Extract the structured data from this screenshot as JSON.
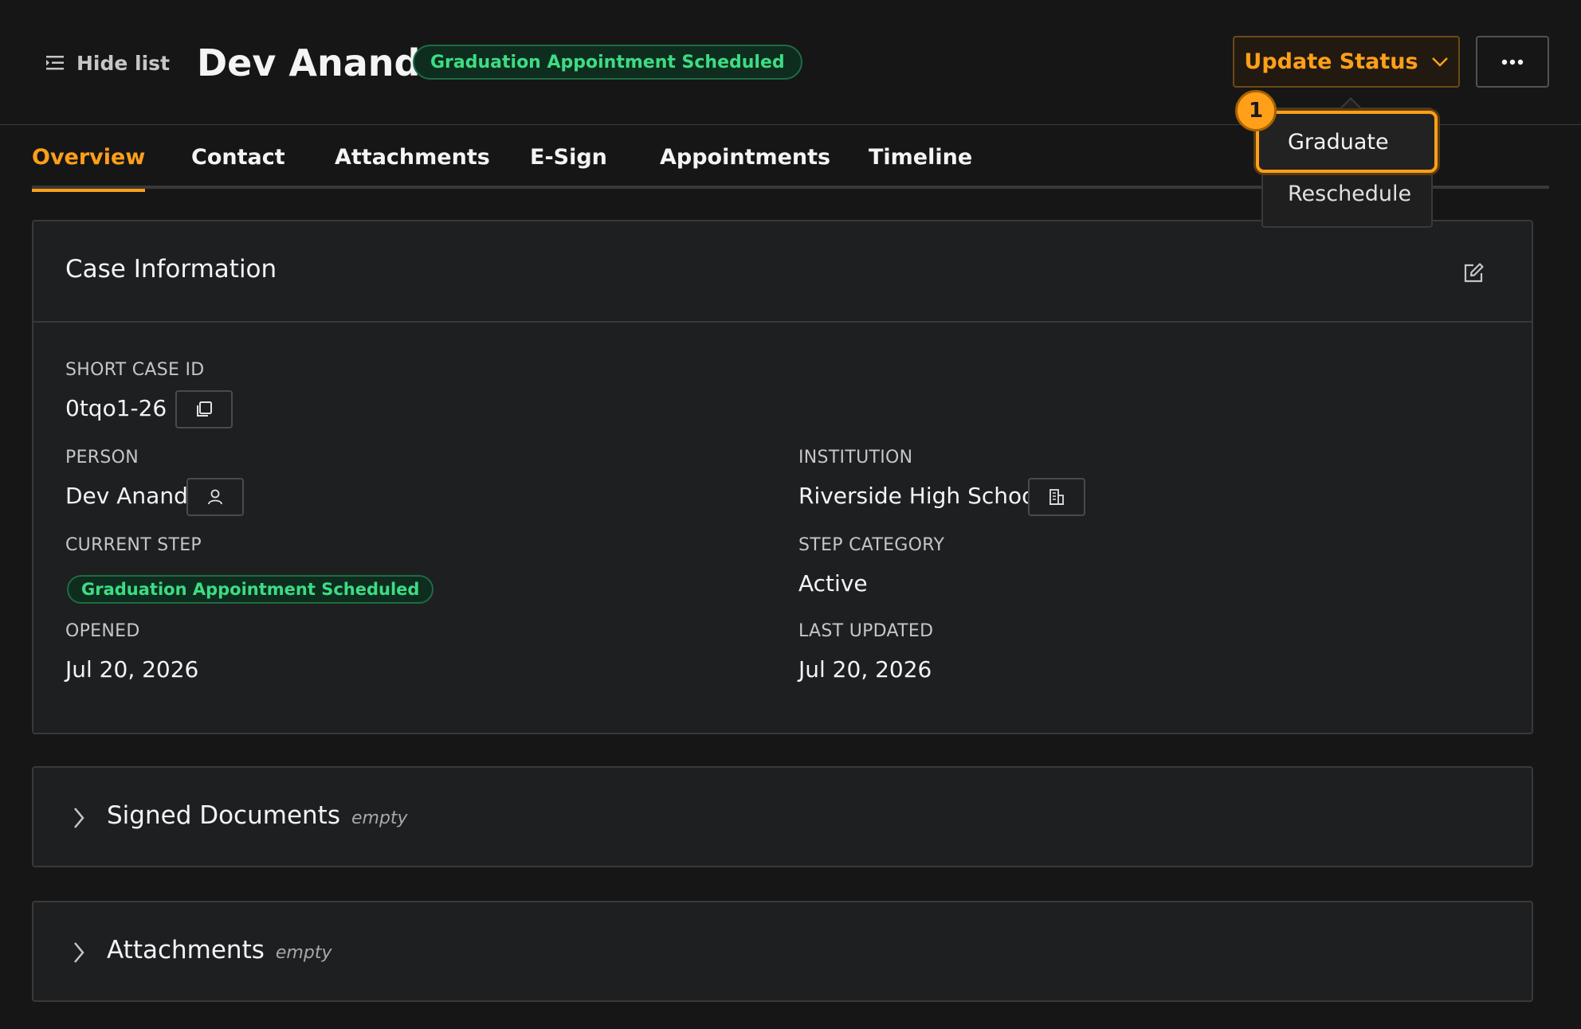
{
  "header": {
    "hide_list_label": "Hide list",
    "person_name": "Dev Anand",
    "status_tag": "Graduation Appointment Scheduled",
    "update_status_label": "Update Status"
  },
  "dropdown": {
    "items": [
      "Graduate",
      "Reschedule"
    ],
    "marker": "1"
  },
  "tabs": [
    "Overview",
    "Contact",
    "Attachments",
    "E-Sign",
    "Appointments",
    "Timeline"
  ],
  "active_tab": "Overview",
  "case_info": {
    "title": "Case Information",
    "short_case_id_label": "SHORT CASE ID",
    "short_case_id": "0tqo1-26",
    "person_label": "PERSON",
    "person": "Dev Anand",
    "institution_label": "INSTITUTION",
    "institution": "Riverside High School",
    "current_step_label": "CURRENT STEP",
    "current_step": "Graduation Appointment Scheduled",
    "step_category_label": "STEP CATEGORY",
    "step_category": "Active",
    "opened_label": "OPENED",
    "opened": "Jul 20, 2026",
    "last_updated_label": "LAST UPDATED",
    "last_updated": "Jul 20, 2026"
  },
  "sections": [
    {
      "title": "Signed Documents",
      "note": "empty"
    },
    {
      "title": "Attachments",
      "note": "empty"
    }
  ],
  "colors": {
    "accent": "#ff9f1a",
    "success": "#3ddc84",
    "background": "#161616",
    "card": "#1e1f21"
  }
}
